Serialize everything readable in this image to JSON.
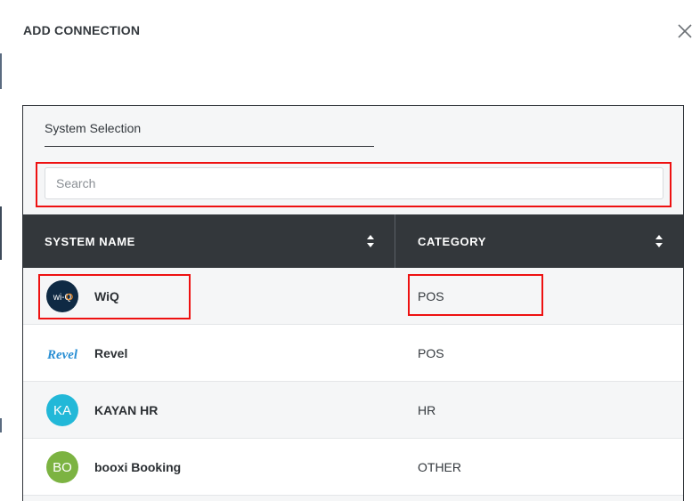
{
  "dialog": {
    "title": "ADD CONNECTION",
    "close_icon": "close-icon"
  },
  "panel": {
    "selection_tab_label": "System Selection",
    "search": {
      "placeholder": "Search",
      "value": ""
    }
  },
  "table": {
    "columns": [
      {
        "label": "SYSTEM NAME",
        "sort_icon": "sort-icon"
      },
      {
        "label": "CATEGORY",
        "sort_icon": "sort-icon"
      }
    ],
    "rows": [
      {
        "name": "WiQ",
        "category": "POS",
        "avatar_text": "wi-Q",
        "avatar_color": "#0f2a44"
      },
      {
        "name": "Revel",
        "category": "POS",
        "avatar_text": "Revel",
        "avatar_color": "#2a8fd4"
      },
      {
        "name": "KAYAN HR",
        "category": "HR",
        "avatar_text": "KA",
        "avatar_color": "#22b8d8"
      },
      {
        "name": "booxi Booking",
        "category": "OTHER",
        "avatar_text": "BO",
        "avatar_color": "#7cb342"
      }
    ]
  },
  "colors": {
    "header_bg": "#33373b",
    "highlight": "#ee1111"
  }
}
